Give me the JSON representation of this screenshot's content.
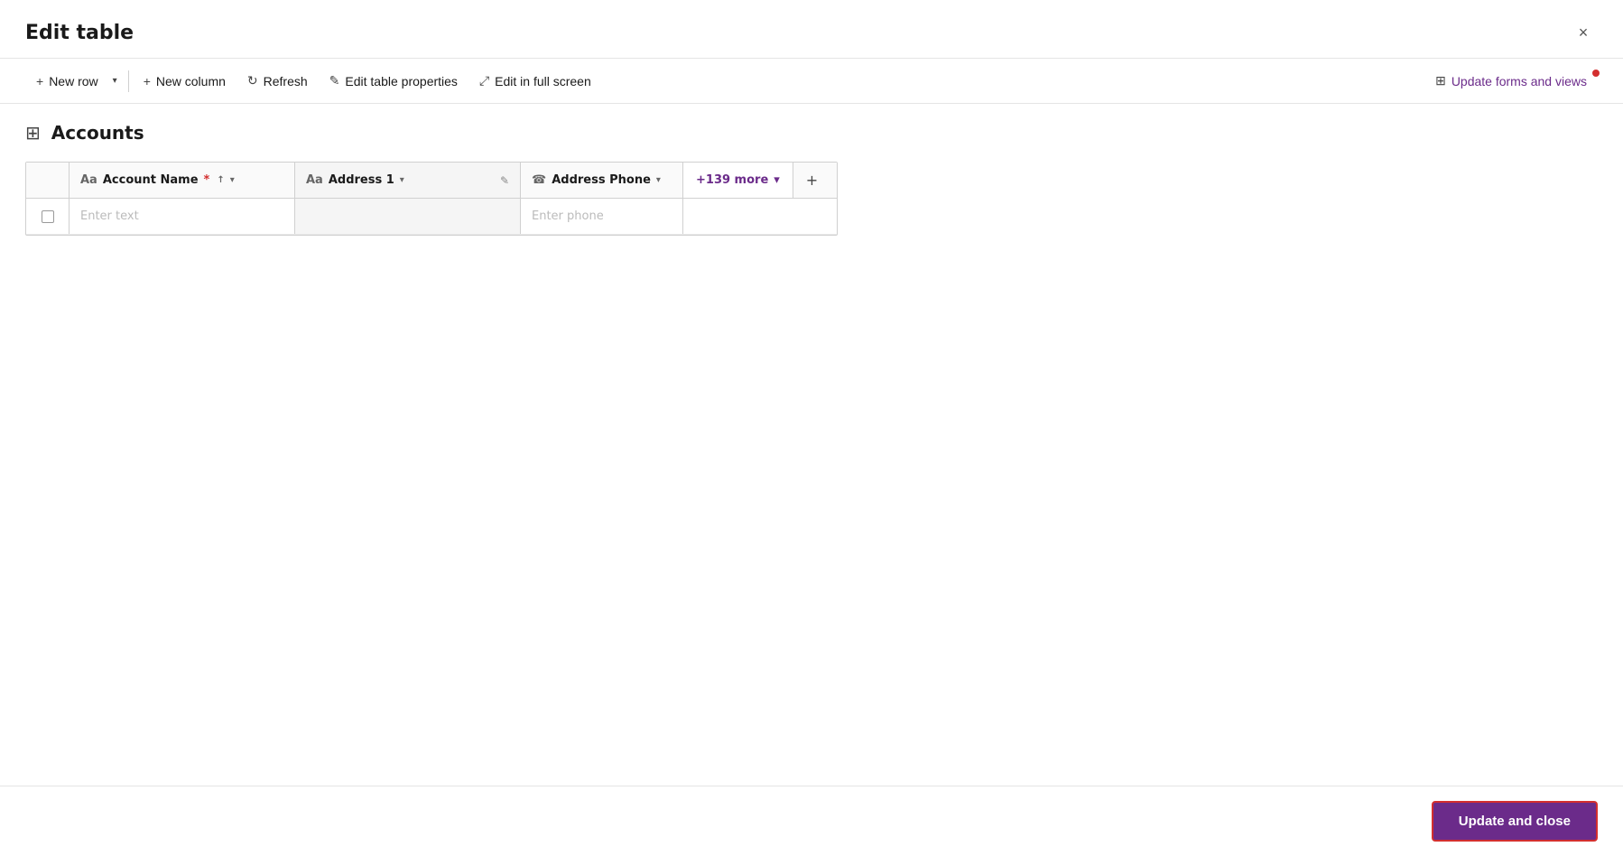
{
  "dialog": {
    "title": "Edit table",
    "close_label": "×"
  },
  "toolbar": {
    "new_row_label": "New row",
    "new_row_dropdown": "▾",
    "new_column_label": "New column",
    "refresh_label": "Refresh",
    "edit_table_props_label": "Edit table properties",
    "edit_fullscreen_label": "Edit in full screen",
    "update_forms_label": "Update forms and views",
    "icons": {
      "plus": "+",
      "refresh": "↻",
      "pencil": "✎",
      "expand": "⤢",
      "table_update": "⊞"
    }
  },
  "table": {
    "name": "Accounts",
    "grid_icon": "⊞",
    "columns": [
      {
        "id": "account_name",
        "label": "Account Name",
        "required": true,
        "type_icon": "Aa",
        "sort": "↑",
        "dropdown": true
      },
      {
        "id": "address1",
        "label": "Address 1",
        "type_icon": "Aa",
        "dropdown": true,
        "edit_icon": true
      },
      {
        "id": "address_phone",
        "label": "Address Phone",
        "type_icon": "☎",
        "dropdown": true
      }
    ],
    "more_columns": "+139 more",
    "add_column": "+",
    "rows": [
      {
        "account_name_placeholder": "Enter text",
        "address1_value": "",
        "address_phone_placeholder": "Enter phone"
      }
    ]
  },
  "footer": {
    "update_close_label": "Update and close"
  }
}
